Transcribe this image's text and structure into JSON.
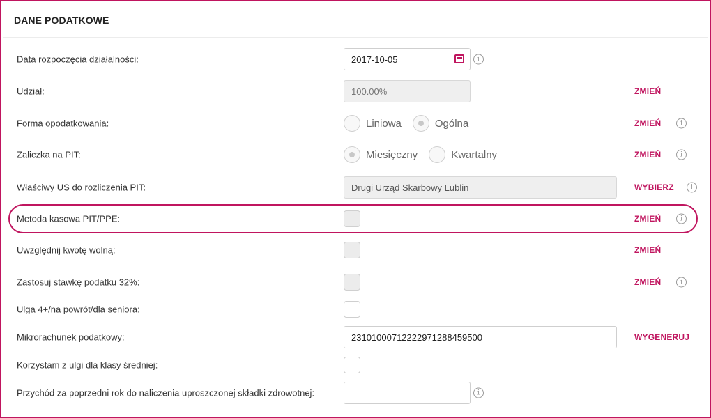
{
  "section": {
    "title": "DANE PODATKOWE"
  },
  "rows": {
    "start_date": {
      "label": "Data rozpoczęcia działalności:",
      "value": "2017-10-05"
    },
    "share": {
      "label": "Udział:",
      "value": "100.00%",
      "action": "ZMIEŃ"
    },
    "tax_form": {
      "label": "Forma opodatkowania:",
      "options": [
        "Liniowa",
        "Ogólna"
      ],
      "selected": "Ogólna",
      "action": "ZMIEŃ"
    },
    "pit_advance": {
      "label": "Zaliczka na PIT:",
      "options": [
        "Miesięczny",
        "Kwartalny"
      ],
      "selected": "Miesięczny",
      "action": "ZMIEŃ"
    },
    "tax_office": {
      "label": "Właściwy US do rozliczenia PIT:",
      "value": "Drugi Urząd Skarbowy Lublin",
      "action": "WYBIERZ"
    },
    "cash_method": {
      "label": "Metoda kasowa PIT/PPE:",
      "checked": false,
      "action": "ZMIEŃ"
    },
    "tax_free_amount": {
      "label": "Uwzględnij kwotę wolną:",
      "checked": false,
      "action": "ZMIEŃ"
    },
    "rate_32": {
      "label": "Zastosuj stawkę podatku 32%:",
      "checked": false,
      "action": "ZMIEŃ"
    },
    "relief_4plus": {
      "label": "Ulga 4+/na powrót/dla seniora:",
      "checked": false
    },
    "micro_account": {
      "label": "Mikrorachunek podatkowy:",
      "value": "23101000712222971288459500",
      "action": "WYGENERUJ"
    },
    "middle_class": {
      "label": "Korzystam z ulgi dla klasy średniej:",
      "checked": false
    },
    "prev_year_income": {
      "label": "Przychód za poprzedni rok do naliczenia uproszczonej składki zdrowotnej:",
      "value": ""
    }
  },
  "icons": {
    "info": "info-icon",
    "calendar": "calendar-icon"
  },
  "colors": {
    "accent": "#c0155f"
  }
}
